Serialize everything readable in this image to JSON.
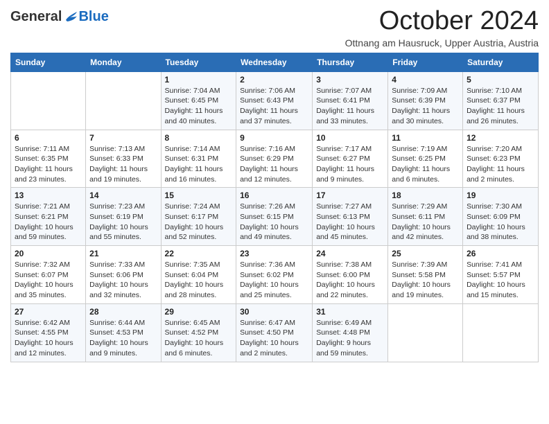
{
  "header": {
    "logo": {
      "general": "General",
      "blue": "Blue",
      "tagline": ""
    },
    "title": "October 2024",
    "subtitle": "Ottnang am Hausruck, Upper Austria, Austria"
  },
  "calendar": {
    "days_of_week": [
      "Sunday",
      "Monday",
      "Tuesday",
      "Wednesday",
      "Thursday",
      "Friday",
      "Saturday"
    ],
    "weeks": [
      [
        {
          "day": "",
          "sunrise": "",
          "sunset": "",
          "daylight": ""
        },
        {
          "day": "",
          "sunrise": "",
          "sunset": "",
          "daylight": ""
        },
        {
          "day": "1",
          "sunrise": "Sunrise: 7:04 AM",
          "sunset": "Sunset: 6:45 PM",
          "daylight": "Daylight: 11 hours and 40 minutes."
        },
        {
          "day": "2",
          "sunrise": "Sunrise: 7:06 AM",
          "sunset": "Sunset: 6:43 PM",
          "daylight": "Daylight: 11 hours and 37 minutes."
        },
        {
          "day": "3",
          "sunrise": "Sunrise: 7:07 AM",
          "sunset": "Sunset: 6:41 PM",
          "daylight": "Daylight: 11 hours and 33 minutes."
        },
        {
          "day": "4",
          "sunrise": "Sunrise: 7:09 AM",
          "sunset": "Sunset: 6:39 PM",
          "daylight": "Daylight: 11 hours and 30 minutes."
        },
        {
          "day": "5",
          "sunrise": "Sunrise: 7:10 AM",
          "sunset": "Sunset: 6:37 PM",
          "daylight": "Daylight: 11 hours and 26 minutes."
        }
      ],
      [
        {
          "day": "6",
          "sunrise": "Sunrise: 7:11 AM",
          "sunset": "Sunset: 6:35 PM",
          "daylight": "Daylight: 11 hours and 23 minutes."
        },
        {
          "day": "7",
          "sunrise": "Sunrise: 7:13 AM",
          "sunset": "Sunset: 6:33 PM",
          "daylight": "Daylight: 11 hours and 19 minutes."
        },
        {
          "day": "8",
          "sunrise": "Sunrise: 7:14 AM",
          "sunset": "Sunset: 6:31 PM",
          "daylight": "Daylight: 11 hours and 16 minutes."
        },
        {
          "day": "9",
          "sunrise": "Sunrise: 7:16 AM",
          "sunset": "Sunset: 6:29 PM",
          "daylight": "Daylight: 11 hours and 12 minutes."
        },
        {
          "day": "10",
          "sunrise": "Sunrise: 7:17 AM",
          "sunset": "Sunset: 6:27 PM",
          "daylight": "Daylight: 11 hours and 9 minutes."
        },
        {
          "day": "11",
          "sunrise": "Sunrise: 7:19 AM",
          "sunset": "Sunset: 6:25 PM",
          "daylight": "Daylight: 11 hours and 6 minutes."
        },
        {
          "day": "12",
          "sunrise": "Sunrise: 7:20 AM",
          "sunset": "Sunset: 6:23 PM",
          "daylight": "Daylight: 11 hours and 2 minutes."
        }
      ],
      [
        {
          "day": "13",
          "sunrise": "Sunrise: 7:21 AM",
          "sunset": "Sunset: 6:21 PM",
          "daylight": "Daylight: 10 hours and 59 minutes."
        },
        {
          "day": "14",
          "sunrise": "Sunrise: 7:23 AM",
          "sunset": "Sunset: 6:19 PM",
          "daylight": "Daylight: 10 hours and 55 minutes."
        },
        {
          "day": "15",
          "sunrise": "Sunrise: 7:24 AM",
          "sunset": "Sunset: 6:17 PM",
          "daylight": "Daylight: 10 hours and 52 minutes."
        },
        {
          "day": "16",
          "sunrise": "Sunrise: 7:26 AM",
          "sunset": "Sunset: 6:15 PM",
          "daylight": "Daylight: 10 hours and 49 minutes."
        },
        {
          "day": "17",
          "sunrise": "Sunrise: 7:27 AM",
          "sunset": "Sunset: 6:13 PM",
          "daylight": "Daylight: 10 hours and 45 minutes."
        },
        {
          "day": "18",
          "sunrise": "Sunrise: 7:29 AM",
          "sunset": "Sunset: 6:11 PM",
          "daylight": "Daylight: 10 hours and 42 minutes."
        },
        {
          "day": "19",
          "sunrise": "Sunrise: 7:30 AM",
          "sunset": "Sunset: 6:09 PM",
          "daylight": "Daylight: 10 hours and 38 minutes."
        }
      ],
      [
        {
          "day": "20",
          "sunrise": "Sunrise: 7:32 AM",
          "sunset": "Sunset: 6:07 PM",
          "daylight": "Daylight: 10 hours and 35 minutes."
        },
        {
          "day": "21",
          "sunrise": "Sunrise: 7:33 AM",
          "sunset": "Sunset: 6:06 PM",
          "daylight": "Daylight: 10 hours and 32 minutes."
        },
        {
          "day": "22",
          "sunrise": "Sunrise: 7:35 AM",
          "sunset": "Sunset: 6:04 PM",
          "daylight": "Daylight: 10 hours and 28 minutes."
        },
        {
          "day": "23",
          "sunrise": "Sunrise: 7:36 AM",
          "sunset": "Sunset: 6:02 PM",
          "daylight": "Daylight: 10 hours and 25 minutes."
        },
        {
          "day": "24",
          "sunrise": "Sunrise: 7:38 AM",
          "sunset": "Sunset: 6:00 PM",
          "daylight": "Daylight: 10 hours and 22 minutes."
        },
        {
          "day": "25",
          "sunrise": "Sunrise: 7:39 AM",
          "sunset": "Sunset: 5:58 PM",
          "daylight": "Daylight: 10 hours and 19 minutes."
        },
        {
          "day": "26",
          "sunrise": "Sunrise: 7:41 AM",
          "sunset": "Sunset: 5:57 PM",
          "daylight": "Daylight: 10 hours and 15 minutes."
        }
      ],
      [
        {
          "day": "27",
          "sunrise": "Sunrise: 6:42 AM",
          "sunset": "Sunset: 4:55 PM",
          "daylight": "Daylight: 10 hours and 12 minutes."
        },
        {
          "day": "28",
          "sunrise": "Sunrise: 6:44 AM",
          "sunset": "Sunset: 4:53 PM",
          "daylight": "Daylight: 10 hours and 9 minutes."
        },
        {
          "day": "29",
          "sunrise": "Sunrise: 6:45 AM",
          "sunset": "Sunset: 4:52 PM",
          "daylight": "Daylight: 10 hours and 6 minutes."
        },
        {
          "day": "30",
          "sunrise": "Sunrise: 6:47 AM",
          "sunset": "Sunset: 4:50 PM",
          "daylight": "Daylight: 10 hours and 2 minutes."
        },
        {
          "day": "31",
          "sunrise": "Sunrise: 6:49 AM",
          "sunset": "Sunset: 4:48 PM",
          "daylight": "Daylight: 9 hours and 59 minutes."
        },
        {
          "day": "",
          "sunrise": "",
          "sunset": "",
          "daylight": ""
        },
        {
          "day": "",
          "sunrise": "",
          "sunset": "",
          "daylight": ""
        }
      ]
    ]
  }
}
